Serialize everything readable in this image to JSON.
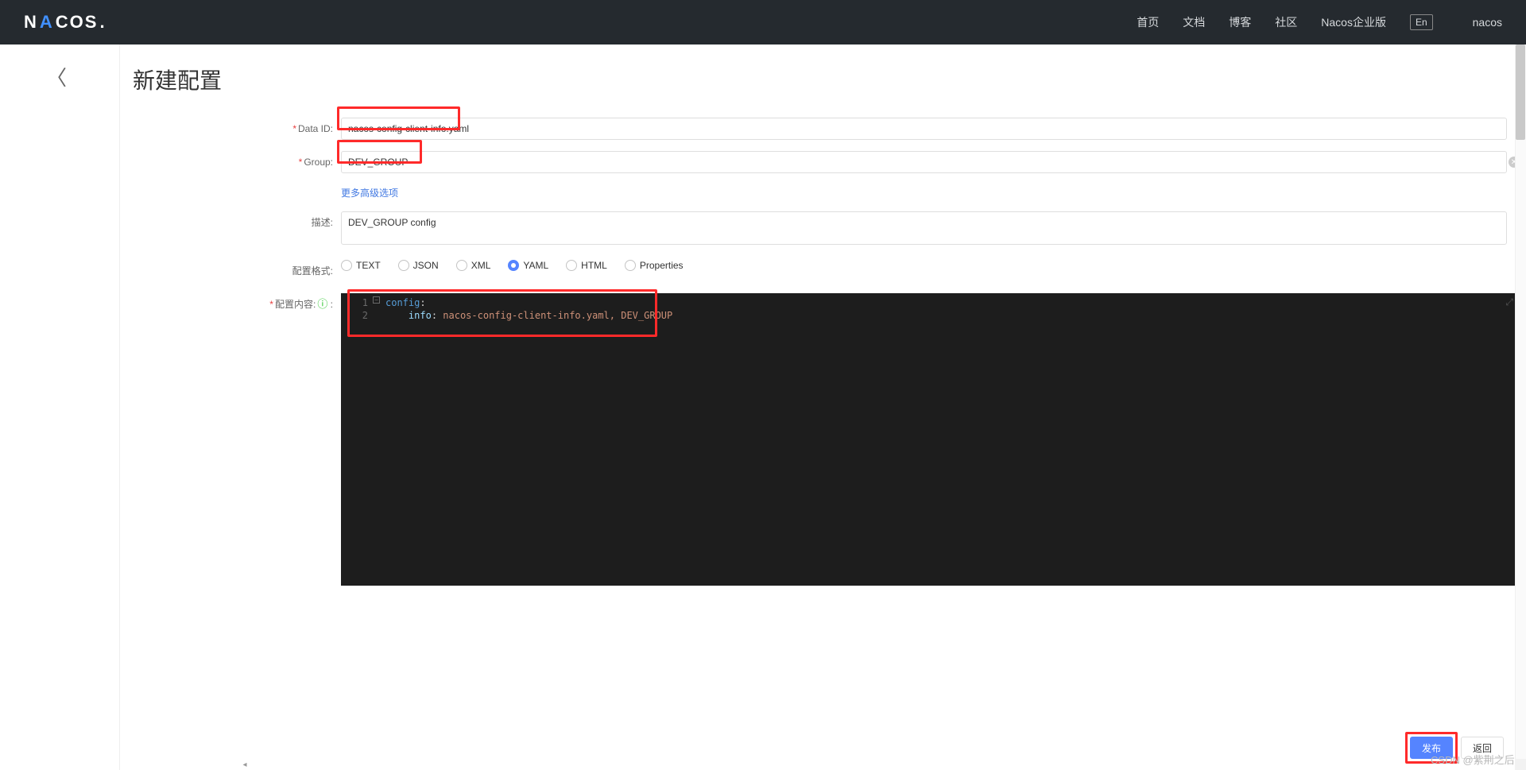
{
  "header": {
    "logo_text": "NACOS.",
    "nav": {
      "home": "首页",
      "docs": "文档",
      "blog": "博客",
      "community": "社区",
      "enterprise": "Nacos企业版",
      "lang": "En",
      "user": "nacos"
    }
  },
  "page": {
    "title": "新建配置",
    "back_arrow": "〈"
  },
  "form": {
    "data_id": {
      "label": "Data ID:",
      "value": "nacos-config-client-info.yaml"
    },
    "group": {
      "label": "Group:",
      "value": "DEV_GROUP"
    },
    "advanced_link": "更多高级选项",
    "desc": {
      "label": "描述:",
      "value": "DEV_GROUP config"
    },
    "format": {
      "label": "配置格式:",
      "options": {
        "text": "TEXT",
        "json": "JSON",
        "xml": "XML",
        "yaml": "YAML",
        "html": "HTML",
        "properties": "Properties"
      },
      "selected": "yaml"
    },
    "content": {
      "label": "配置内容:",
      "lines": [
        {
          "n": "1",
          "raw": "config:",
          "k": "config",
          "c": ":"
        },
        {
          "n": "2",
          "raw": "    info: nacos-config-client-info.yaml, DEV_GROUP",
          "indent": "    ",
          "k": "info",
          "c": ": ",
          "v": "nacos-config-client-info.yaml, DEV_GROUP"
        }
      ]
    }
  },
  "buttons": {
    "publish": "发布",
    "back": "返回"
  },
  "watermark": "CSDN @紫荆之后-"
}
